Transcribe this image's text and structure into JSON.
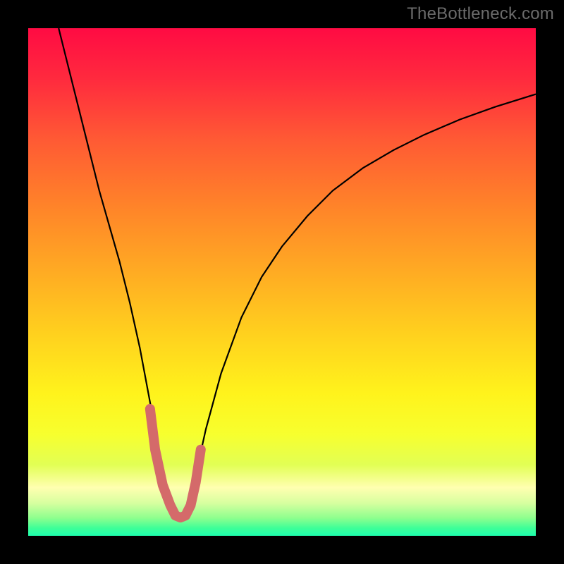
{
  "watermark": "TheBottleneck.com",
  "gradient": {
    "stops": [
      {
        "offset": 0.0,
        "color": "#ff0b43"
      },
      {
        "offset": 0.1,
        "color": "#ff2a3e"
      },
      {
        "offset": 0.22,
        "color": "#ff5a34"
      },
      {
        "offset": 0.35,
        "color": "#ff8329"
      },
      {
        "offset": 0.48,
        "color": "#ffab23"
      },
      {
        "offset": 0.6,
        "color": "#ffd01e"
      },
      {
        "offset": 0.72,
        "color": "#fff31c"
      },
      {
        "offset": 0.8,
        "color": "#f7ff2e"
      },
      {
        "offset": 0.86,
        "color": "#e2ff54"
      },
      {
        "offset": 0.905,
        "color": "#ffffb0"
      },
      {
        "offset": 0.935,
        "color": "#d8ffa0"
      },
      {
        "offset": 0.965,
        "color": "#8eff8e"
      },
      {
        "offset": 0.985,
        "color": "#3dff98"
      },
      {
        "offset": 1.0,
        "color": "#1effae"
      }
    ]
  },
  "chart_data": {
    "type": "line",
    "title": "",
    "xlabel": "",
    "ylabel": "",
    "xlim": [
      0,
      100
    ],
    "ylim": [
      0,
      100
    ],
    "series": [
      {
        "name": "bottleneck-curve",
        "stroke": "#000000",
        "stroke_width": 2.2,
        "x": [
          6,
          8,
          10,
          12,
          14,
          16,
          18,
          20,
          22,
          23.5,
          25,
          26.5,
          28,
          29,
          30,
          31,
          32,
          33,
          35,
          38,
          42,
          46,
          50,
          55,
          60,
          66,
          72,
          78,
          85,
          92,
          100
        ],
        "y": [
          100,
          92,
          84,
          76,
          68,
          61,
          54,
          46,
          37,
          29,
          21,
          13,
          7,
          4,
          3,
          4,
          7,
          12,
          21,
          32,
          43,
          51,
          57,
          63,
          68,
          72.5,
          76,
          79,
          82,
          84.5,
          87
        ]
      },
      {
        "name": "bottom-marker",
        "stroke": "#d46a6a",
        "stroke_width": 14,
        "linecap": "round",
        "x": [
          24.0,
          25.0,
          26.5,
          28.0,
          29.0,
          30.0,
          31.0,
          32.0,
          33.0,
          34.0
        ],
        "y": [
          25.0,
          17.0,
          10.0,
          6.0,
          4.0,
          3.6,
          4.0,
          6.0,
          10.5,
          17.0
        ]
      }
    ]
  }
}
